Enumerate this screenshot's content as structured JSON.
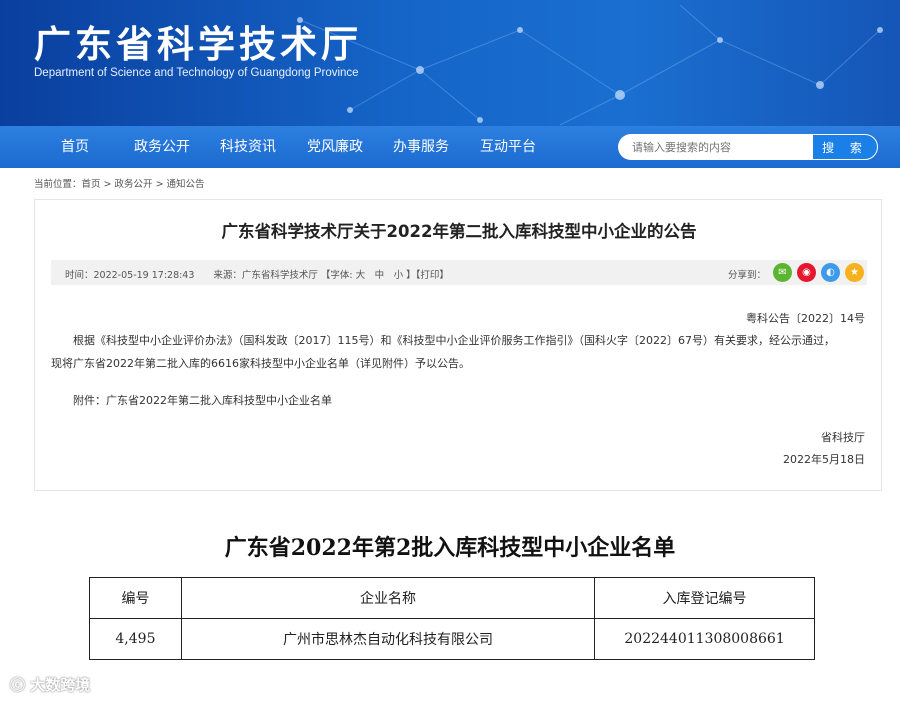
{
  "header": {
    "site_title": "广东省科学技术厅",
    "site_subtitle": "Department of Science and Technology of Guangdong Province"
  },
  "nav": {
    "items": [
      "首页",
      "政务公开",
      "科技资讯",
      "党风廉政",
      "办事服务",
      "互动平台"
    ],
    "search_placeholder": "请输入要搜索的内容",
    "search_button": "搜 索"
  },
  "breadcrumb": {
    "label": "当前位置：",
    "crumbs": [
      "首页",
      "政务公开",
      "通知公告"
    ],
    "separator": " > "
  },
  "article": {
    "title": "广东省科学技术厅关于2022年第二批入库科技型中小企业的公告",
    "meta": "时间：2022-05-19 17:28:43　　来源：广东省科学技术厅 【字体: 大　中　小 】【打印】",
    "share_label": "分享到：",
    "share_icons": [
      {
        "name": "wechat-icon",
        "glyph": "✉",
        "color": "#5cb531"
      },
      {
        "name": "weibo-icon",
        "glyph": "◉",
        "color": "#e6162d"
      },
      {
        "name": "qq-icon",
        "glyph": "◐",
        "color": "#3d9be9"
      },
      {
        "name": "qzone-icon",
        "glyph": "★",
        "color": "#f5b21e"
      }
    ],
    "doc_number": "粤科公告〔2022〕14号",
    "body_p1": "根据《科技型中小企业评价办法》（国科发政〔2017〕115号）和《科技型中小企业评价服务工作指引》（国科火字〔2022〕67号）有关要求，经公示通过，",
    "body_p2": "现将广东省2022年第二批入库的6616家科技型中小企业名单（详见附件）予以公告。",
    "attachment": "附件：广东省2022年第二批入库科技型中小企业名单",
    "signer": "省科技厅",
    "sign_date": "2022年5月18日"
  },
  "list": {
    "title": "广东省2022年第2批入库科技型中小企业名单",
    "columns": [
      "编号",
      "企业名称",
      "入库登记编号"
    ],
    "rows": [
      [
        "4,495",
        "广州市思林杰自动化科技有限公司",
        "202244011308008661"
      ]
    ]
  },
  "watermark": "大数跨境"
}
